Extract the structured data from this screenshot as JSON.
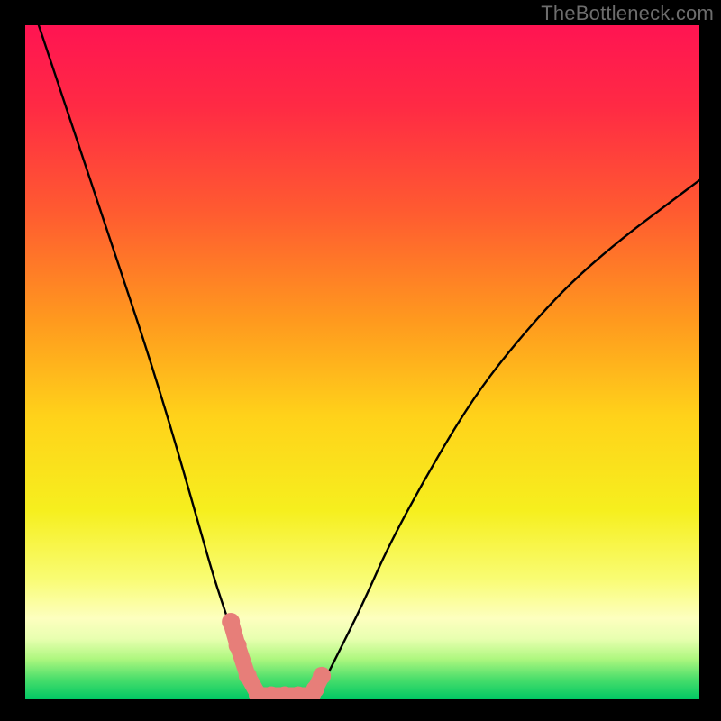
{
  "attribution": "TheBottleneck.com",
  "chart_data": {
    "type": "line",
    "title": "",
    "xlabel": "",
    "ylabel": "",
    "xlim": [
      0,
      100
    ],
    "ylim": [
      0,
      100
    ],
    "grid": false,
    "legend": false,
    "series": [
      {
        "name": "left-curve",
        "x": [
          2,
          6,
          10,
          14,
          18,
          22,
          26,
          28,
          30,
          32,
          34,
          35
        ],
        "y": [
          100,
          88,
          76,
          64,
          52,
          39,
          25,
          18,
          12,
          6,
          2,
          0.5
        ]
      },
      {
        "name": "right-curve",
        "x": [
          42,
          44,
          46,
          50,
          54,
          60,
          66,
          72,
          80,
          88,
          96,
          100
        ],
        "y": [
          0.5,
          2,
          6,
          14,
          23,
          34,
          44,
          52,
          61,
          68,
          74,
          77
        ]
      }
    ],
    "flat_segment": {
      "x": [
        35,
        42
      ],
      "y": 0.5
    },
    "markers": [
      {
        "name": "left-worm",
        "x": [
          30.5,
          31.5,
          33.0,
          34.5
        ],
        "y": [
          11.5,
          8.0,
          3.5,
          0.8
        ]
      },
      {
        "name": "right-worm-start",
        "x": [
          43.0,
          44.0
        ],
        "y": [
          1.5,
          3.5
        ]
      },
      {
        "name": "bottom-worm",
        "x": [
          34.5,
          36.5,
          38.5,
          40.5,
          42.5
        ],
        "y": [
          0.6,
          0.6,
          0.6,
          0.6,
          0.6
        ]
      }
    ],
    "background_gradient": {
      "stops": [
        {
          "offset": 0.0,
          "color": "#ff1452"
        },
        {
          "offset": 0.12,
          "color": "#ff2a44"
        },
        {
          "offset": 0.28,
          "color": "#ff5c30"
        },
        {
          "offset": 0.44,
          "color": "#ff9a1e"
        },
        {
          "offset": 0.58,
          "color": "#ffd21a"
        },
        {
          "offset": 0.72,
          "color": "#f6ef1e"
        },
        {
          "offset": 0.82,
          "color": "#f9fc72"
        },
        {
          "offset": 0.88,
          "color": "#fdffbf"
        },
        {
          "offset": 0.91,
          "color": "#e8ffb0"
        },
        {
          "offset": 0.94,
          "color": "#aef77f"
        },
        {
          "offset": 0.97,
          "color": "#4ade6b"
        },
        {
          "offset": 1.0,
          "color": "#00c864"
        }
      ]
    },
    "marker_color": "#e77e79",
    "curve_color": "#000000"
  }
}
